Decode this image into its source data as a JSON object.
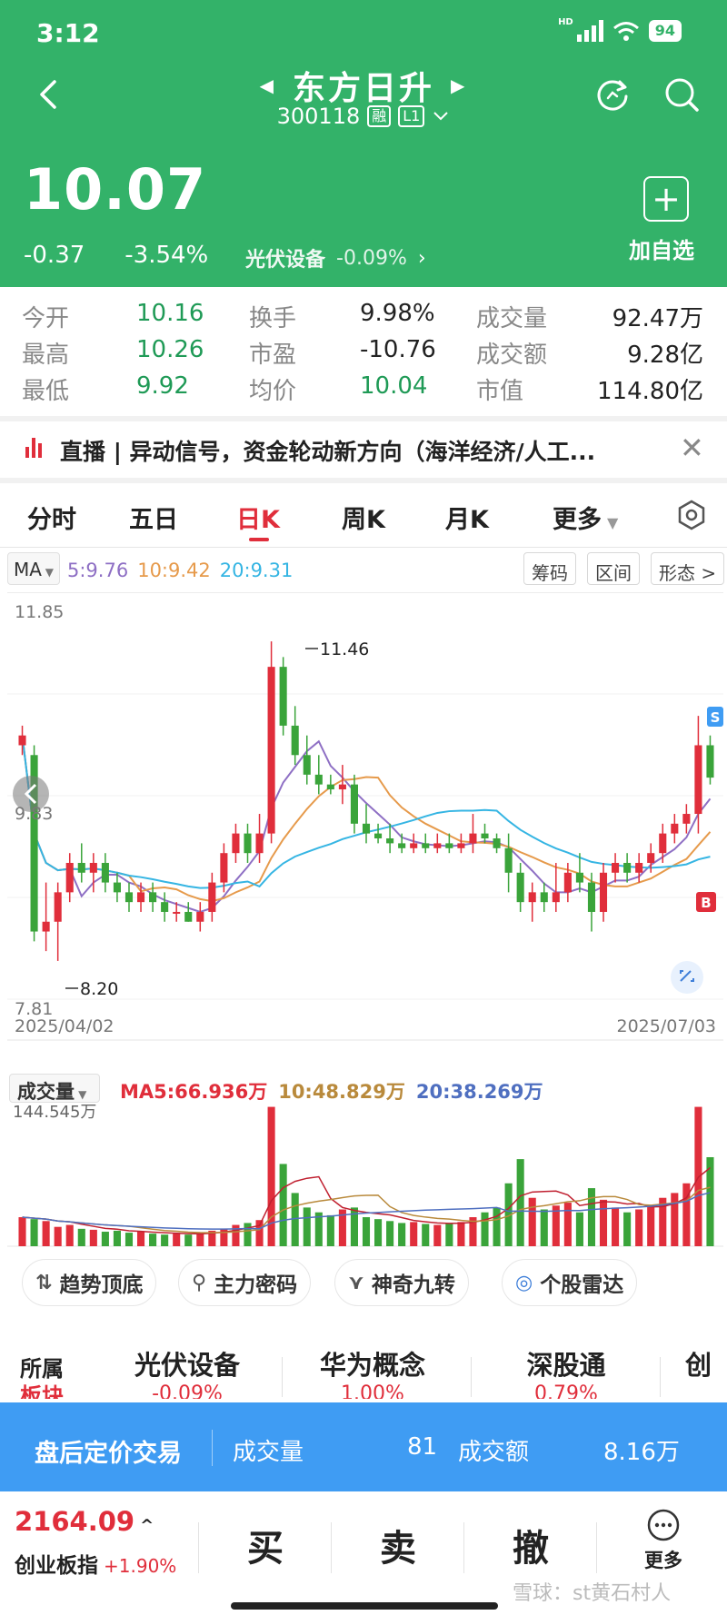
{
  "status": {
    "time": "3:12",
    "network": "HD",
    "battery": "94"
  },
  "nav": {
    "title": "东方日升",
    "code": "300118",
    "margin_tag": "融",
    "level_tag": "L1",
    "prev_icon": "triangle-left-icon",
    "next_icon": "triangle-right-icon"
  },
  "quote": {
    "price": "10.07",
    "change": "-0.37",
    "change_pct": "-3.54%",
    "sector_name": "光伏设备",
    "sector_pct": "-0.09%",
    "add_label": "加自选"
  },
  "stats": {
    "open_label": "今开",
    "open": "10.16",
    "turnover_label": "换手",
    "turnover": "9.98%",
    "volume_label": "成交量",
    "volume": "92.47万",
    "high_label": "最高",
    "high": "10.26",
    "pe_label": "市盈",
    "pe": "-10.76",
    "amount_label": "成交额",
    "amount": "9.28亿",
    "low_label": "最低",
    "low": "9.92",
    "avg_label": "均价",
    "avg": "10.04",
    "mcap_label": "市值",
    "mcap": "114.80亿"
  },
  "live": {
    "text": "直播 | 异动信号，资金轮动新方向（海洋经济/人工..."
  },
  "tabs": [
    "分时",
    "五日",
    "日K",
    "周K",
    "月K",
    "更多"
  ],
  "ma": {
    "button": "MA",
    "ma5": "5:9.76",
    "ma10": "10:9.42",
    "ma20": "20:9.31",
    "chips": [
      "筹码",
      "区间",
      "形态 >"
    ]
  },
  "kline": {
    "y_top": "11.85",
    "y_mid": "9.83",
    "y_bot": "7.81",
    "max_label": "11.46",
    "min_label": "8.20",
    "date_start": "2025/04/02",
    "date_end": "2025/07/03",
    "marker_s": "S",
    "marker_b": "B"
  },
  "volume": {
    "button": "成交量",
    "max_label": "144.545万",
    "ma5": "MA5:66.936万",
    "ma10": "10:48.829万",
    "ma20": "20:38.269万"
  },
  "tools": [
    "趋势顶底",
    "主力密码",
    "神奇九转",
    "个股雷达"
  ],
  "sectors": {
    "title_top": "所属",
    "title_bottom": "板块",
    "items": [
      {
        "name": "光伏设备",
        "pct": "-0.09%"
      },
      {
        "name": "华为概念",
        "pct": "1.00%"
      },
      {
        "name": "深股通",
        "pct": "0.79%"
      },
      {
        "name": "创",
        "pct": ""
      }
    ]
  },
  "after_hours": {
    "title": "盘后定价交易",
    "vol_label": "成交量",
    "vol": "81",
    "amt_label": "成交额",
    "amt": "8.16万"
  },
  "bottom": {
    "index_value": "2164.09",
    "index_name": "创业板指",
    "index_change": "+1.90%",
    "buy": "买",
    "sell": "卖",
    "cancel": "撤",
    "more": "更多"
  },
  "watermark": "雪球：st黄石村人",
  "colors": {
    "header_green": "#33b269",
    "up_red": "#e02e3b",
    "down_green": "#3aa43a",
    "ma5": "#8e6fc4",
    "ma10": "#e69a4b",
    "ma20": "#35b5e3",
    "after_blue": "#3f9cf3"
  },
  "chart_data": {
    "type": "candlestick",
    "price_range": [
      7.81,
      11.85
    ],
    "candles": [
      [
        10.4,
        10.6,
        10.3,
        10.5
      ],
      [
        10.3,
        10.4,
        8.4,
        8.5
      ],
      [
        8.5,
        9.0,
        8.3,
        8.6
      ],
      [
        8.6,
        9.0,
        8.2,
        8.9
      ],
      [
        8.9,
        9.3,
        8.8,
        9.2
      ],
      [
        9.2,
        9.4,
        9.0,
        9.1
      ],
      [
        9.1,
        9.3,
        8.9,
        9.2
      ],
      [
        9.2,
        9.3,
        8.9,
        9.0
      ],
      [
        9.0,
        9.1,
        8.8,
        8.9
      ],
      [
        8.9,
        9.0,
        8.7,
        8.8
      ],
      [
        8.8,
        9.0,
        8.7,
        8.9
      ],
      [
        8.9,
        9.0,
        8.7,
        8.8
      ],
      [
        8.8,
        8.9,
        8.6,
        8.7
      ],
      [
        8.7,
        8.8,
        8.6,
        8.7
      ],
      [
        8.7,
        8.8,
        8.6,
        8.6
      ],
      [
        8.6,
        8.8,
        8.5,
        8.7
      ],
      [
        8.7,
        9.1,
        8.6,
        9.0
      ],
      [
        9.0,
        9.4,
        8.9,
        9.3
      ],
      [
        9.3,
        9.6,
        9.2,
        9.5
      ],
      [
        9.5,
        9.6,
        9.2,
        9.3
      ],
      [
        9.3,
        9.7,
        9.2,
        9.5
      ],
      [
        9.5,
        11.46,
        9.4,
        11.2
      ],
      [
        11.2,
        11.3,
        10.5,
        10.6
      ],
      [
        10.6,
        10.8,
        10.2,
        10.3
      ],
      [
        10.3,
        10.5,
        10.0,
        10.1
      ],
      [
        10.1,
        10.3,
        9.9,
        10.0
      ],
      [
        10.0,
        10.1,
        9.9,
        9.95
      ],
      [
        9.95,
        10.2,
        9.8,
        10.0
      ],
      [
        10.0,
        10.1,
        9.5,
        9.6
      ],
      [
        9.6,
        9.8,
        9.4,
        9.5
      ],
      [
        9.5,
        9.6,
        9.4,
        9.45
      ],
      [
        9.45,
        9.6,
        9.3,
        9.4
      ],
      [
        9.4,
        9.5,
        9.3,
        9.35
      ],
      [
        9.35,
        9.5,
        9.3,
        9.4
      ],
      [
        9.4,
        9.5,
        9.3,
        9.35
      ],
      [
        9.35,
        9.5,
        9.3,
        9.4
      ],
      [
        9.4,
        9.5,
        9.3,
        9.35
      ],
      [
        9.35,
        9.5,
        9.3,
        9.4
      ],
      [
        9.4,
        9.7,
        9.3,
        9.5
      ],
      [
        9.5,
        9.6,
        9.4,
        9.45
      ],
      [
        9.45,
        9.5,
        9.3,
        9.35
      ],
      [
        9.35,
        9.5,
        8.9,
        9.1
      ],
      [
        9.1,
        9.2,
        8.7,
        8.8
      ],
      [
        8.8,
        9.0,
        8.6,
        8.9
      ],
      [
        8.9,
        9.0,
        8.7,
        8.8
      ],
      [
        8.8,
        9.2,
        8.7,
        8.9
      ],
      [
        8.9,
        9.2,
        8.8,
        9.1
      ],
      [
        9.1,
        9.3,
        8.9,
        9.0
      ],
      [
        9.0,
        9.1,
        8.5,
        8.7
      ],
      [
        8.7,
        9.2,
        8.6,
        9.1
      ],
      [
        9.1,
        9.3,
        9.0,
        9.2
      ],
      [
        9.2,
        9.3,
        9.0,
        9.1
      ],
      [
        9.1,
        9.3,
        9.0,
        9.2
      ],
      [
        9.2,
        9.4,
        9.1,
        9.3
      ],
      [
        9.3,
        9.6,
        9.2,
        9.5
      ],
      [
        9.5,
        9.7,
        9.4,
        9.6
      ],
      [
        9.6,
        9.8,
        9.5,
        9.7
      ],
      [
        9.7,
        10.7,
        9.5,
        10.4
      ],
      [
        10.4,
        10.5,
        10.0,
        10.07
      ]
    ],
    "volume_max": 144.545,
    "volume": [
      30,
      28,
      26,
      20,
      22,
      18,
      17,
      15,
      16,
      14,
      15,
      13,
      12,
      13,
      12,
      14,
      16,
      18,
      22,
      24,
      27,
      144,
      85,
      55,
      40,
      35,
      32,
      38,
      40,
      30,
      28,
      26,
      24,
      25,
      23,
      22,
      24,
      25,
      30,
      35,
      40,
      65,
      90,
      50,
      38,
      42,
      45,
      35,
      60,
      48,
      40,
      35,
      38,
      42,
      50,
      55,
      65,
      144,
      92
    ],
    "volume_up": [
      1,
      0,
      1,
      1,
      1,
      0,
      1,
      0,
      0,
      0,
      1,
      0,
      0,
      1,
      0,
      1,
      1,
      1,
      1,
      0,
      1,
      1,
      0,
      0,
      0,
      0,
      0,
      1,
      0,
      0,
      0,
      0,
      0,
      1,
      0,
      1,
      0,
      1,
      1,
      0,
      0,
      0,
      0,
      1,
      0,
      1,
      1,
      0,
      0,
      1,
      1,
      0,
      1,
      1,
      1,
      1,
      1,
      1,
      0
    ]
  }
}
